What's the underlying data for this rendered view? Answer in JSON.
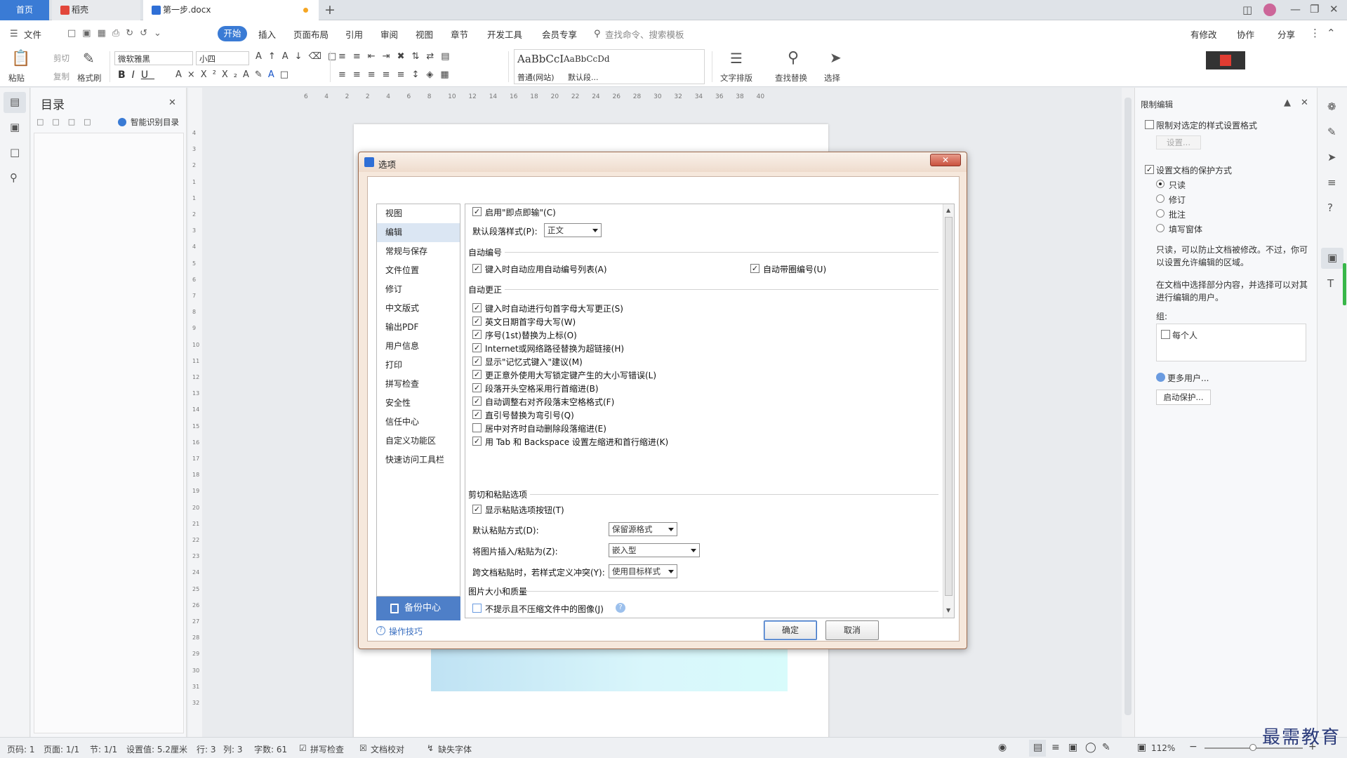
{
  "tabs": {
    "home": "首页",
    "docer": "稻壳",
    "doc": "第一步.docx",
    "add": "+"
  },
  "menu": {
    "file": "文件",
    "items": [
      "开始",
      "插入",
      "页面布局",
      "引用",
      "审阅",
      "视图",
      "章节",
      "开发工具",
      "会员专享"
    ],
    "search": "查找命令、搜索模板",
    "right": [
      "有修改",
      "协作",
      "分享"
    ]
  },
  "ribbon": {
    "paste": "粘贴",
    "cut": "剪切",
    "copy": "复制",
    "format_painter": "格式刷",
    "font": "微软雅黑",
    "size": "小四",
    "style1_preview": "AaBbCcI",
    "style1_name": "普通(网站)",
    "style2_preview": "AaBbCcDd",
    "style2_name": "默认段...",
    "text_layout": "文字排版",
    "find_replace": "查找替换",
    "select": "选择"
  },
  "toc": {
    "title": "目录",
    "smart": "智能识别目录"
  },
  "ruler": {
    "h": [
      "6",
      "4",
      "2",
      "2",
      "4",
      "6",
      "8",
      "10",
      "12",
      "14",
      "16",
      "18",
      "20",
      "22",
      "24",
      "26",
      "28",
      "30",
      "32",
      "34",
      "36",
      "38",
      "40"
    ],
    "v": [
      "4",
      "3",
      "2",
      "1",
      "1",
      "2",
      "3",
      "4",
      "5",
      "6",
      "7",
      "8",
      "9",
      "10",
      "11",
      "12",
      "13",
      "14",
      "15",
      "16",
      "17",
      "18",
      "19",
      "20",
      "21",
      "22",
      "23",
      "24",
      "25",
      "26",
      "27",
      "28",
      "29",
      "30",
      "31",
      "32"
    ]
  },
  "dialog": {
    "title": "选项",
    "categories": [
      "视图",
      "编辑",
      "常规与保存",
      "文件位置",
      "修订",
      "中文版式",
      "输出PDF",
      "用户信息",
      "打印",
      "拼写检查",
      "安全性",
      "信任中心",
      "自定义功能区",
      "快速访问工具栏"
    ],
    "selected_category": "编辑",
    "backup": "备份中心",
    "tips": "操作技巧",
    "ok": "确定",
    "cancel": "取消",
    "instant_input": "启用\"即点即输\"(C)",
    "default_para_label": "默认段落样式(P):",
    "default_para_value": "正文",
    "auto_number_section": "自动编号",
    "auto_number_1": "键入时自动应用自动编号列表(A)",
    "auto_number_2": "自动带圈编号(U)",
    "autocorrect_section": "自动更正",
    "autocorrect": [
      "键入时自动进行句首字母大写更正(S)",
      "英文日期首字母大写(W)",
      "序号(1st)替换为上标(O)",
      "Internet或网络路径替换为超链接(H)",
      "显示\"记忆式键入\"建议(M)",
      "更正意外使用大写锁定键产生的大小写错误(L)",
      "段落开头空格采用行首缩进(B)",
      "自动调整右对齐段落末空格格式(F)",
      "直引号替换为弯引号(Q)",
      "居中对齐时自动删除段落缩进(E)",
      "用 Tab 和 Backspace 设置左缩进和首行缩进(K)"
    ],
    "autocorrect_checked": [
      true,
      true,
      true,
      true,
      true,
      true,
      true,
      true,
      true,
      false,
      true
    ],
    "paste_section": "剪切和粘贴选项",
    "show_paste_btn": "显示粘贴选项按钮(T)",
    "default_paste_label": "默认粘贴方式(D):",
    "default_paste_value": "保留源格式",
    "image_insert_label": "将图片插入/粘贴为(Z):",
    "image_insert_value": "嵌入型",
    "cross_doc_label": "跨文档粘贴时，若样式定义冲突(Y):",
    "cross_doc_value": "使用目标样式",
    "image_section": "图片大小和质量",
    "no_compress": "不提示且不压缩文件中的图像(J)"
  },
  "rpanel": {
    "title": "限制编辑",
    "limit_format": "限制对选定的样式设置格式",
    "settings_btn": "设置...",
    "protect": "设置文档的保护方式",
    "options": [
      "只读",
      "修订",
      "批注",
      "填写窗体"
    ],
    "desc1": "只读，可以防止文档被修改。不过，你可以设置允许编辑的区域。",
    "desc2": "在文档中选择部分内容，并选择可以对其进行编辑的用户。",
    "group": "组:",
    "everyone": "每个人",
    "more_users": "更多用户...",
    "start_protect": "启动保护..."
  },
  "status": {
    "page": "页码: 1",
    "pages": "页面: 1/1",
    "section": "节: 1/1",
    "setting": "设置值: 5.2厘米",
    "row": "行: 3",
    "col": "列: 3",
    "words": "字数: 61",
    "spell": "拼写检查",
    "proof": "文档校对",
    "font_missing": "缺失字体",
    "zoom": "112%"
  },
  "watermark": "最需教育"
}
